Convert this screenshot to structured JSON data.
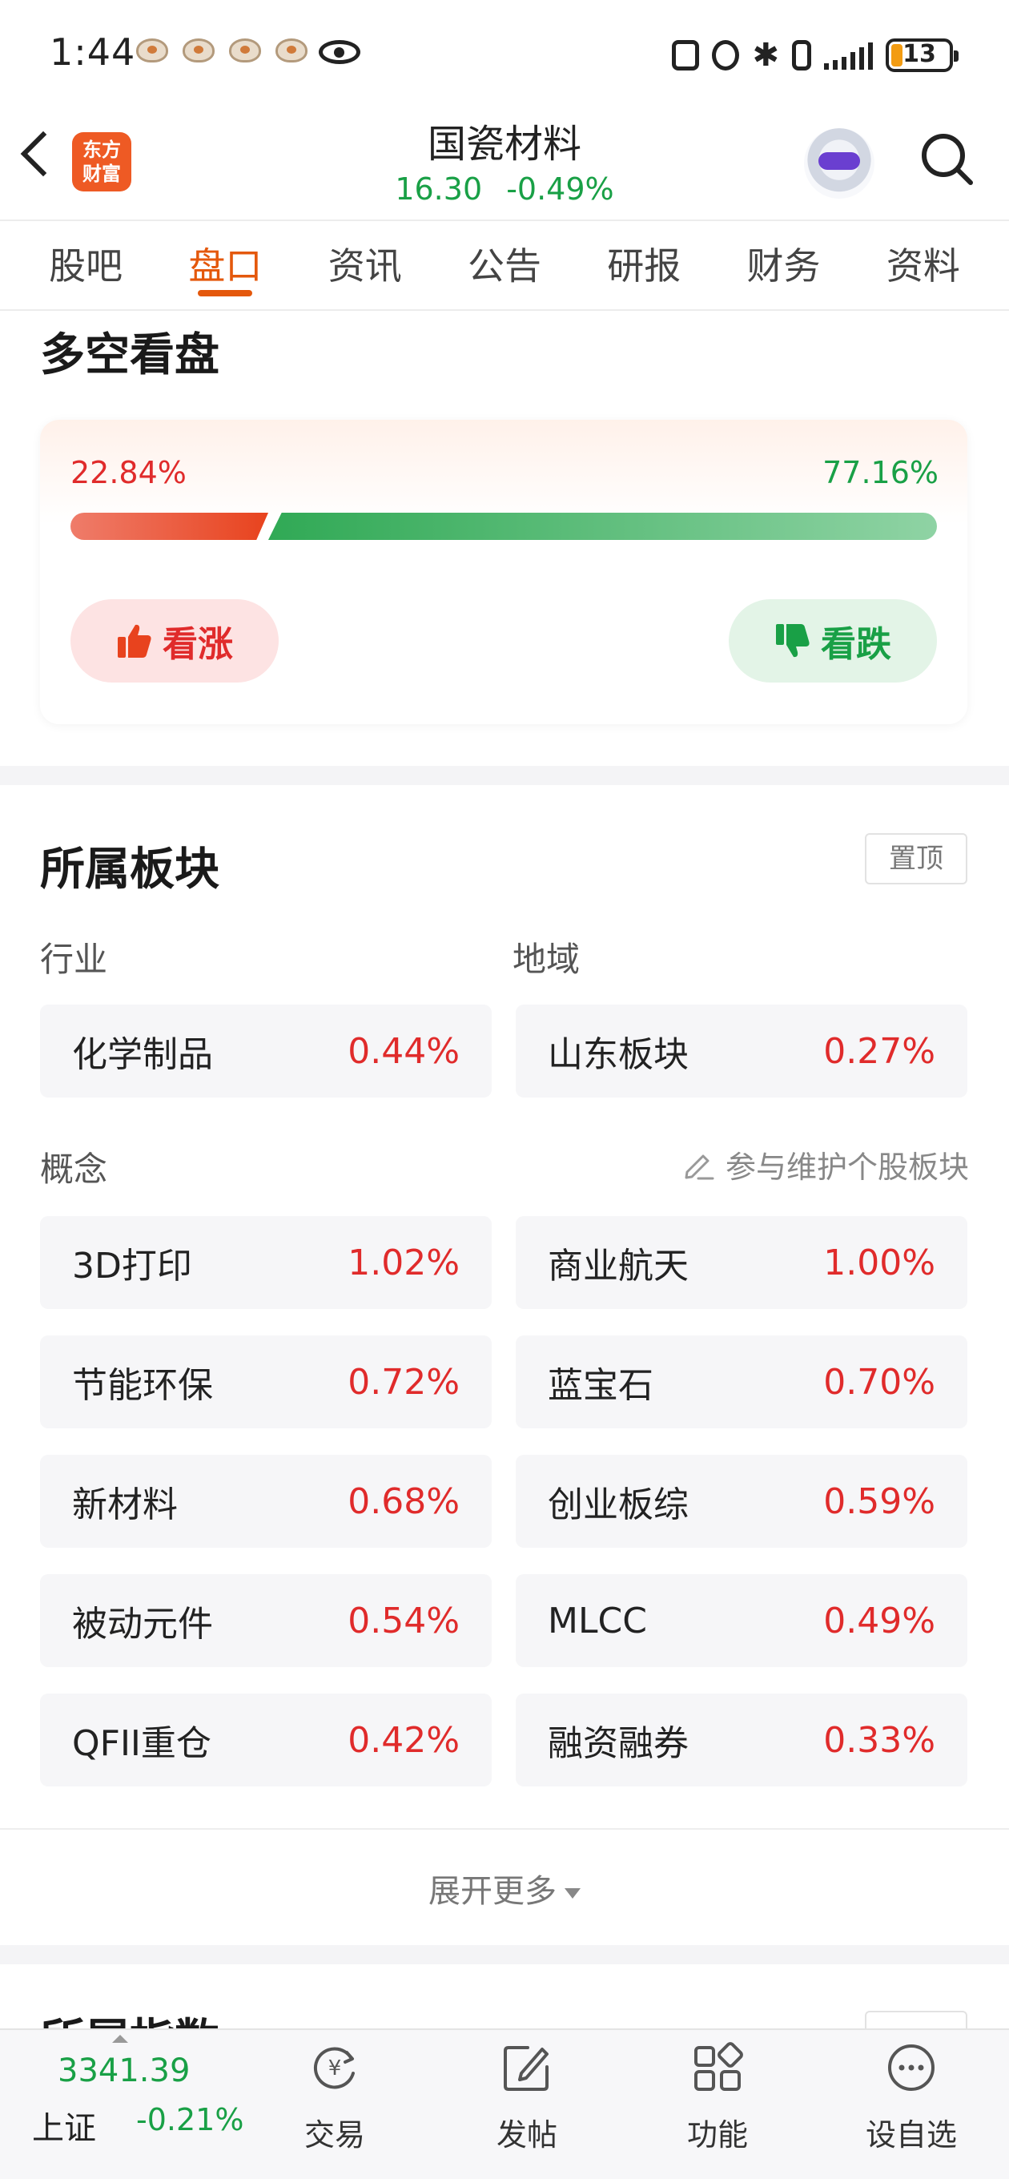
{
  "status_bar": {
    "time": "1:44",
    "battery": "13"
  },
  "header": {
    "stock_name": "国瓷材料",
    "price": "16.30",
    "change_pct": "-0.49%",
    "logo_line1": "东方",
    "logo_line2": "财富"
  },
  "tabs": [
    {
      "label": "股吧",
      "active": false
    },
    {
      "label": "盘口",
      "active": true
    },
    {
      "label": "资讯",
      "active": false
    },
    {
      "label": "公告",
      "active": false
    },
    {
      "label": "研报",
      "active": false
    },
    {
      "label": "财务",
      "active": false
    },
    {
      "label": "资料",
      "active": false
    }
  ],
  "sentiment": {
    "title": "多空看盘",
    "bull_pct": "22.84%",
    "bear_pct": "77.16%",
    "bull_fraction": 0.2284,
    "bull_button": "看涨",
    "bear_button": "看跌"
  },
  "sectors": {
    "title": "所属板块",
    "pin_label": "置顶",
    "industry_label": "行业",
    "region_label": "地域",
    "industry": {
      "name": "化学制品",
      "pct": "0.44%"
    },
    "region": {
      "name": "山东板块",
      "pct": "0.27%"
    },
    "concept_label": "概念",
    "maintain_label": "参与维护个股板块",
    "concepts": [
      {
        "name": "3D打印",
        "pct": "1.02%"
      },
      {
        "name": "商业航天",
        "pct": "1.00%"
      },
      {
        "name": "节能环保",
        "pct": "0.72%"
      },
      {
        "name": "蓝宝石",
        "pct": "0.70%"
      },
      {
        "name": "新材料",
        "pct": "0.68%"
      },
      {
        "name": "创业板综",
        "pct": "0.59%"
      },
      {
        "name": "被动元件",
        "pct": "0.54%"
      },
      {
        "name": "MLCC",
        "pct": "0.49%"
      },
      {
        "name": "QFII重仓",
        "pct": "0.42%"
      },
      {
        "name": "融资融券",
        "pct": "0.33%"
      }
    ],
    "expand_label": "展开更多"
  },
  "next_section_title": "所属指数",
  "bottom_bar": {
    "index_value": "3341.39",
    "index_name": "上证",
    "index_change": "-0.21%",
    "items": [
      {
        "label": "交易",
        "icon": "yen-refresh-icon"
      },
      {
        "label": "发帖",
        "icon": "edit-icon"
      },
      {
        "label": "功能",
        "icon": "grid-icon"
      },
      {
        "label": "设自选",
        "icon": "more-icon"
      }
    ]
  }
}
